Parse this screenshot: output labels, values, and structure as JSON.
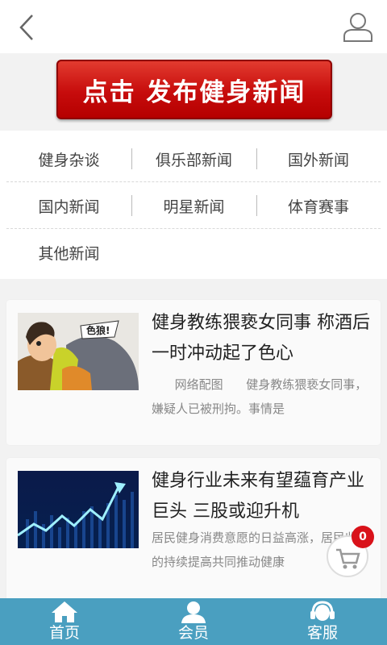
{
  "header": {
    "back_icon": "chevron-left-icon",
    "user_icon": "user-icon"
  },
  "banner": {
    "publish_label": "点击 发布健身新闻",
    "color": "#c70c0c"
  },
  "categories": [
    {
      "label": "健身杂谈"
    },
    {
      "label": "俱乐部新闻"
    },
    {
      "label": "国外新闻"
    },
    {
      "label": "国内新闻"
    },
    {
      "label": "明星新闻"
    },
    {
      "label": "体育赛事"
    },
    {
      "label": "其他新闻"
    }
  ],
  "news": [
    {
      "title": "健身教练猥亵女同事 称酒后一时冲动起了色心",
      "summary": "      网络配图      健身教练猥亵女同事，嫌疑人已被刑拘。事情是",
      "thumb_text": "色狼!"
    },
    {
      "title": "健身行业未来有望蕴育产业巨头 三股或迎升机",
      "summary": "居民健身消费意愿的日益高涨，居民收入的持续提高共同推动健康"
    }
  ],
  "cart": {
    "badge": "0",
    "icon": "cart-icon"
  },
  "bottom_nav": [
    {
      "label": "首页",
      "icon": "home-icon"
    },
    {
      "label": "会员",
      "icon": "member-icon"
    },
    {
      "label": "客服",
      "icon": "service-icon"
    }
  ],
  "colors": {
    "nav_bg": "#4a9fc0",
    "badge": "#d9121a"
  }
}
